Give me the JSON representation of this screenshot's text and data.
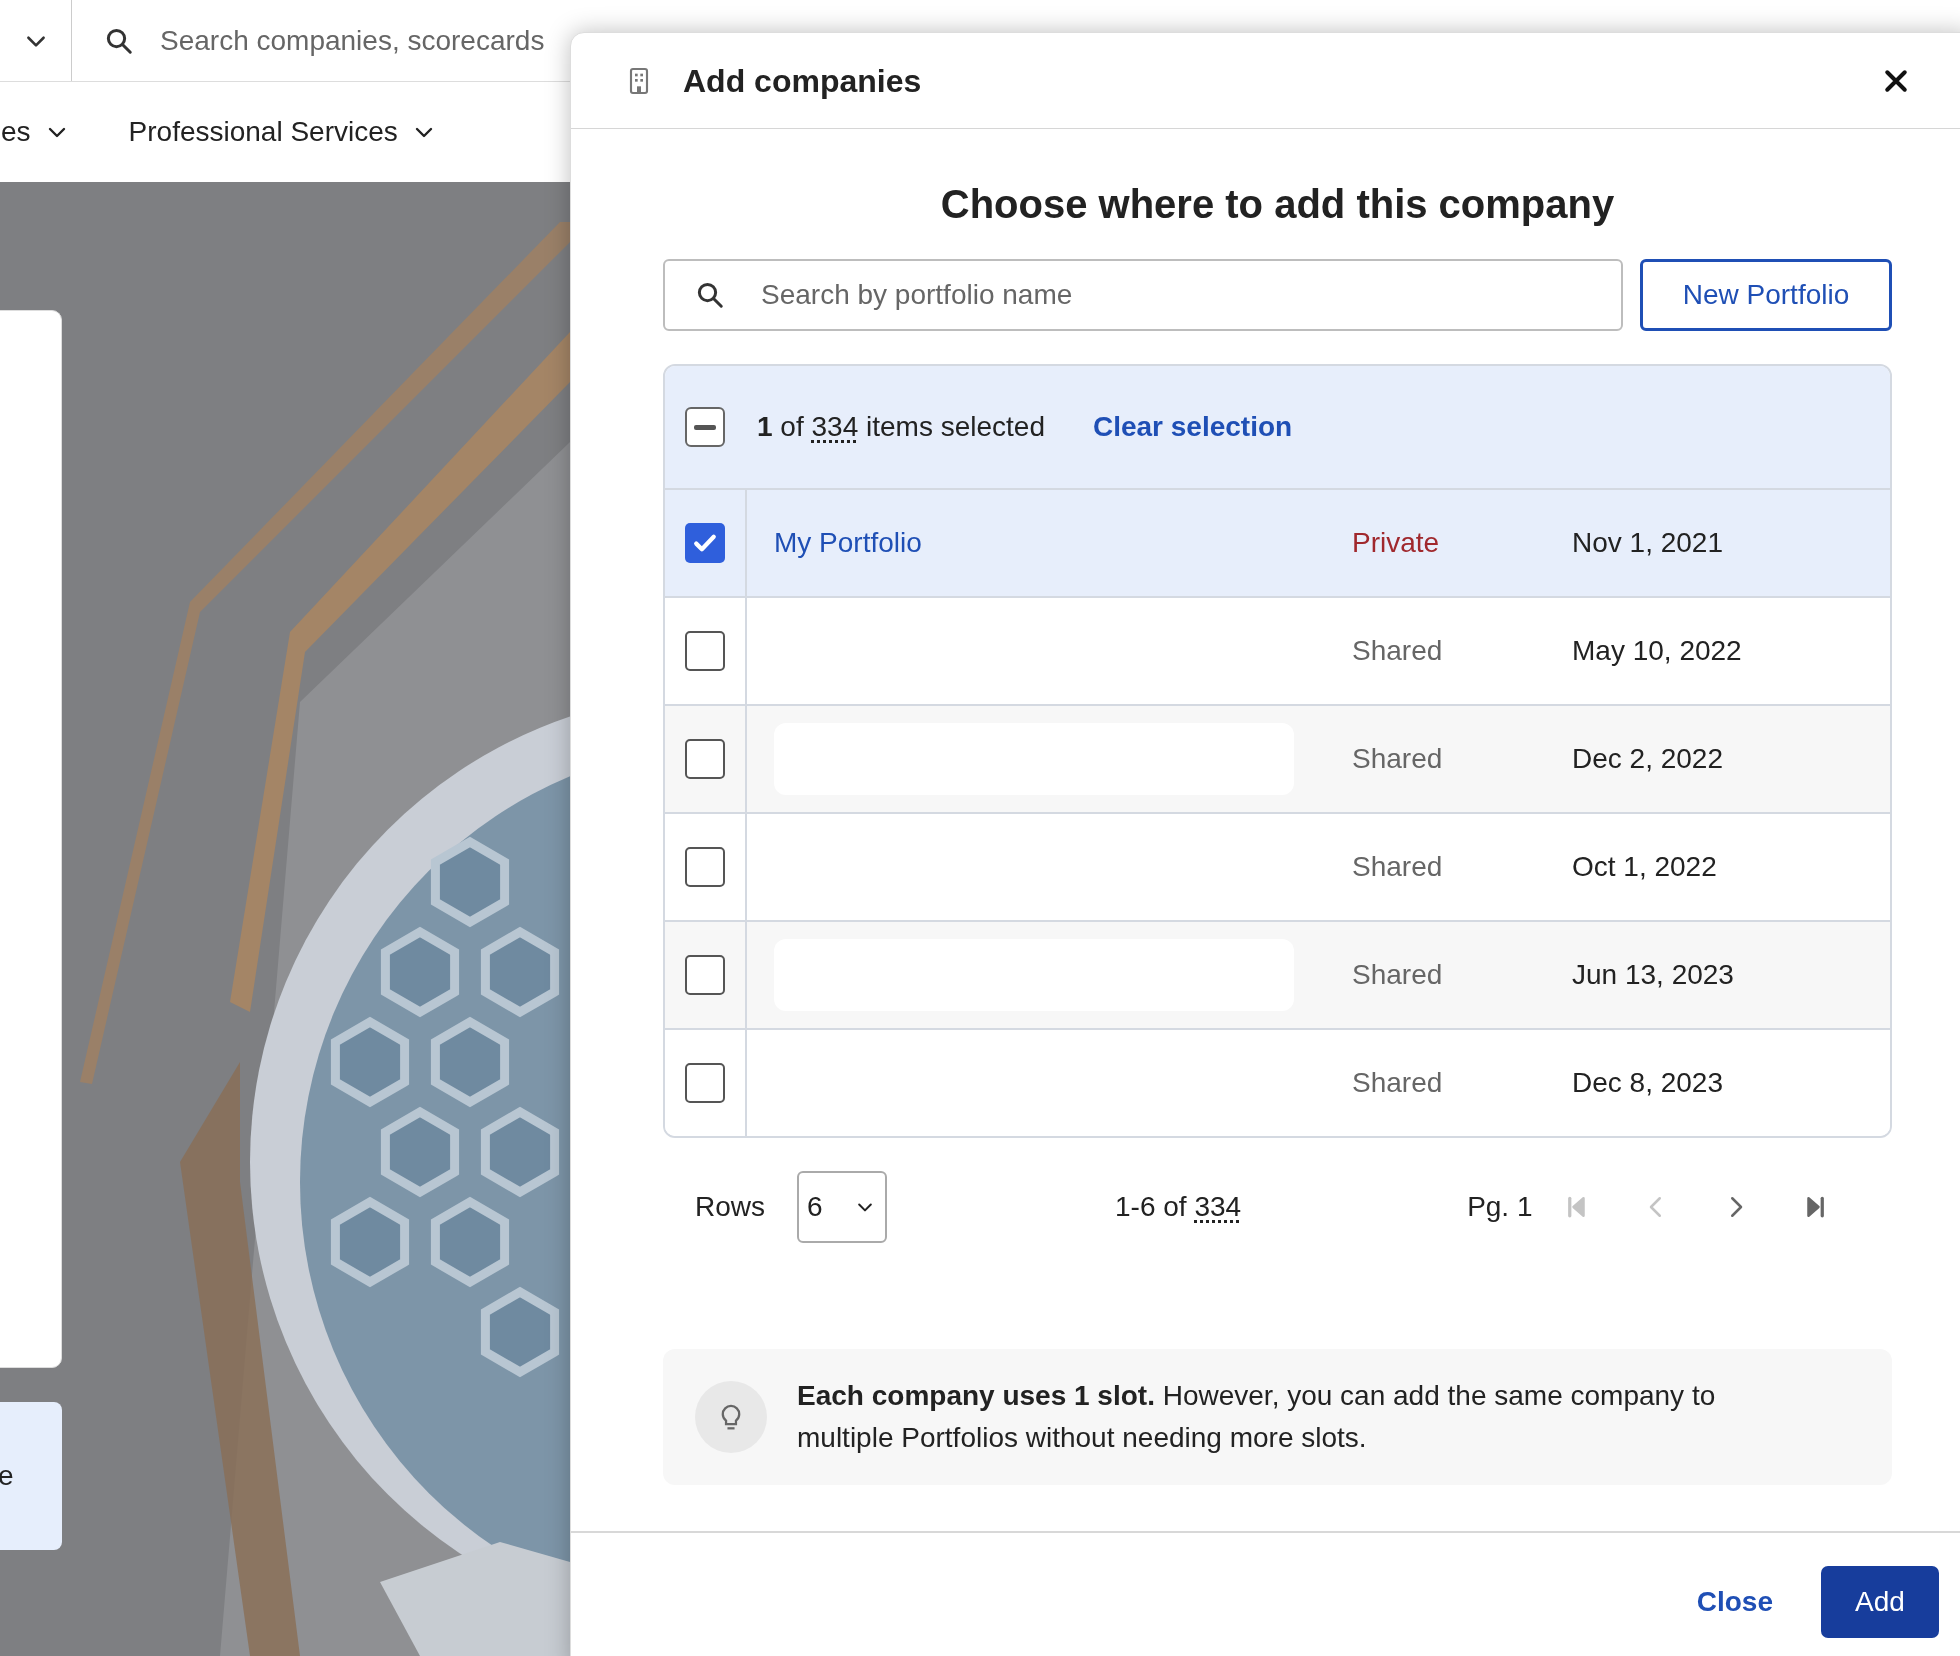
{
  "top_bar": {
    "search_placeholder": "Search companies, scorecards"
  },
  "nav": {
    "items": [
      {
        "label": "es"
      },
      {
        "label": "Professional Services"
      }
    ]
  },
  "background_card": {
    "text": "e"
  },
  "modal": {
    "title": "Add companies",
    "heading": "Choose where to add this company",
    "search": {
      "placeholder": "Search by portfolio name"
    },
    "new_button": "New Portfolio",
    "selection": {
      "partially_checked": true,
      "selected_count": "1",
      "of_label": "of",
      "total": "334",
      "items_label": "items selected",
      "clear": "Clear selection"
    },
    "rows": [
      {
        "name": "My Portfolio",
        "visibility": "Private",
        "kind": "private",
        "date": "Nov 1, 2021",
        "checked": true
      },
      {
        "visibility": "Shared",
        "kind": "shared",
        "date": "May 10, 2022",
        "checked": false
      },
      {
        "visibility": "Shared",
        "kind": "shared",
        "date": "Dec 2, 2022",
        "checked": false
      },
      {
        "visibility": "Shared",
        "kind": "shared",
        "date": "Oct 1, 2022",
        "checked": false
      },
      {
        "visibility": "Shared",
        "kind": "shared",
        "date": "Jun 13, 2023",
        "checked": false
      },
      {
        "visibility": "Shared",
        "kind": "shared",
        "date": "Dec 8, 2023",
        "checked": false
      }
    ],
    "pagination": {
      "rows_label": "Rows",
      "rows_value": "6",
      "range": "1-6",
      "of_label": "of",
      "total": "334",
      "page": "Pg. 1",
      "buttons": [
        {
          "kind": "first",
          "disabled": true
        },
        {
          "kind": "prev",
          "disabled": true
        },
        {
          "kind": "next",
          "disabled": false
        },
        {
          "kind": "last",
          "disabled": false
        }
      ]
    },
    "tip": "**Each company uses 1 slot.** However, you can add the same company to multiple Portfolios without needing more slots.",
    "footer": {
      "close": "Close",
      "add": "Add"
    }
  }
}
